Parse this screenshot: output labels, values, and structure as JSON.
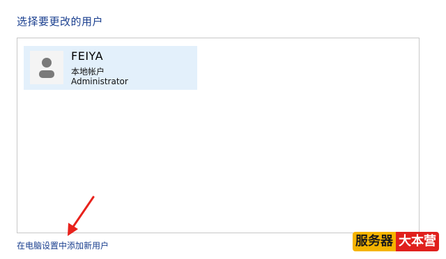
{
  "header": {
    "title": "选择要更改的用户"
  },
  "users": [
    {
      "name": "FEIYA",
      "account_type": "本地帐户",
      "role": "Administrator",
      "avatar_icon": "user-avatar-icon"
    }
  ],
  "footer": {
    "add_user_link": "在电脑设置中添加新用户"
  },
  "watermark": {
    "part1": "服务器",
    "part2": "大本营"
  },
  "colors": {
    "link": "#1a3f8f",
    "tile_selected": "#e3f0fb",
    "arrow": "#e8221c",
    "watermark_yellow": "#f5b400",
    "watermark_red": "#e0201d"
  }
}
